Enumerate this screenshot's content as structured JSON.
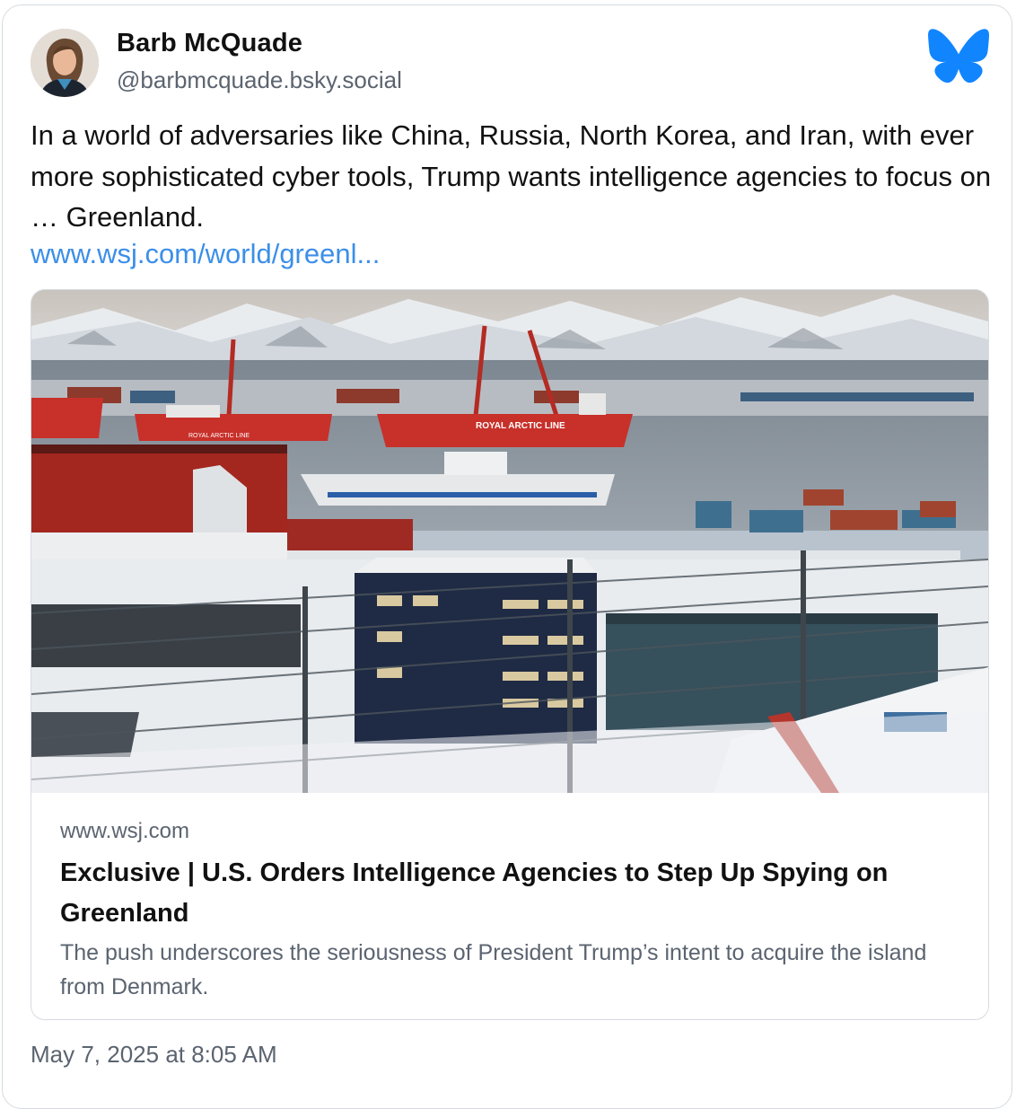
{
  "author": {
    "display_name": "Barb McQuade",
    "handle": "@barbmcquade.bsky.social"
  },
  "post": {
    "text": "In a world of adversaries like China, Russia, North Korea, and Iran, with ever more sophisticated cyber tools, Trump wants intelligence agencies to focus on … Greenland.",
    "link_text": "www.wsj.com/world/greenl..."
  },
  "link_card": {
    "image_icon": "harbor-photo",
    "ship_label": "ROYAL ARCTIC LINE",
    "ship_label_2": "ROYAL ARCTIC LINE",
    "domain": "www.wsj.com",
    "title": "Exclusive | U.S. Orders Intelligence Agencies to Step Up Spying on Greenland",
    "description": "The push underscores the seriousness of President Trump’s intent to acquire the island from Denmark."
  },
  "timestamp": "May 7, 2025 at 8:05 AM",
  "colors": {
    "link": "#3c8fe8",
    "bluesky": "#1185fe",
    "muted_text": "#5b6470"
  },
  "icons": {
    "brand": "bluesky-butterfly-icon"
  }
}
